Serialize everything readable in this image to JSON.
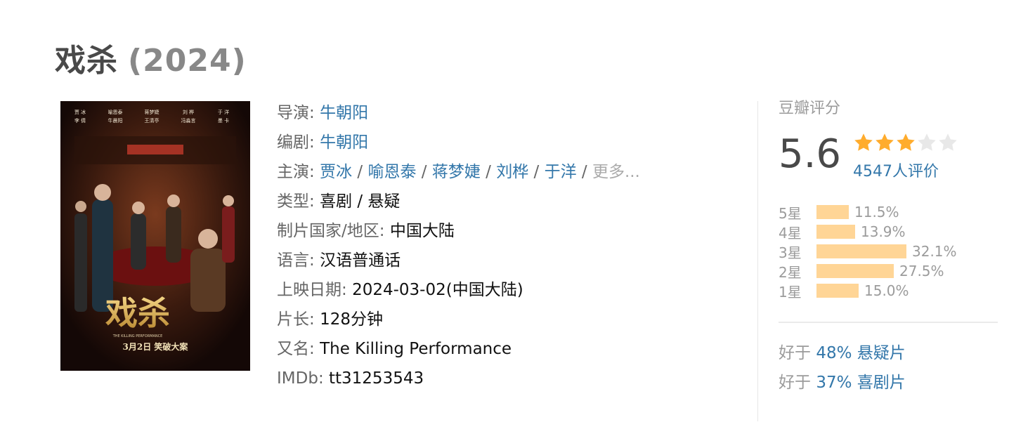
{
  "movie": {
    "title": "戏杀",
    "year": "(2024)"
  },
  "poster": {
    "cast_top": [
      "贾 冰",
      "喻恩泰",
      "蒋梦婕",
      "刘 桦",
      "于 洋"
    ],
    "cast_bottom": [
      "李 倩",
      "牛晨阳",
      "王清亭",
      "冯淼言",
      "墨 卡"
    ],
    "logo": "戏杀",
    "english": "THE KILLING PERFORMANCE",
    "release": "3月2日  笑破大案"
  },
  "info": {
    "director_label": "导演:",
    "director": "牛朝阳",
    "writer_label": "编剧:",
    "writer": "牛朝阳",
    "cast_label": "主演:",
    "cast": [
      "贾冰",
      "喻恩泰",
      "蒋梦婕",
      "刘桦",
      "于洋"
    ],
    "cast_more": "更多...",
    "genre_label": "类型:",
    "genre": "喜剧 / 悬疑",
    "country_label": "制片国家/地区:",
    "country": "中国大陆",
    "language_label": "语言:",
    "language": "汉语普通话",
    "release_label": "上映日期:",
    "release": "2024-03-02(中国大陆)",
    "runtime_label": "片长:",
    "runtime": "128分钟",
    "aka_label": "又名:",
    "aka": "The Killing Performance",
    "imdb_label": "IMDb:",
    "imdb": "tt31253543"
  },
  "rating": {
    "label": "豆瓣评分",
    "score": "5.6",
    "stars": 3,
    "votes": "4547人评价",
    "breakdown": [
      {
        "label": "5星",
        "percent": 11.5,
        "text": "11.5%"
      },
      {
        "label": "4星",
        "percent": 13.9,
        "text": "13.9%"
      },
      {
        "label": "3星",
        "percent": 32.1,
        "text": "32.1%"
      },
      {
        "label": "2星",
        "percent": 27.5,
        "text": "27.5%"
      },
      {
        "label": "1星",
        "percent": 15.0,
        "text": "15.0%"
      }
    ],
    "better_than": [
      {
        "prefix": "好于",
        "text": "48% 悬疑片"
      },
      {
        "prefix": "好于",
        "text": "37% 喜剧片"
      }
    ]
  },
  "colors": {
    "link": "#3377aa",
    "star": "#ffac2d",
    "bar": "#ffd596"
  }
}
